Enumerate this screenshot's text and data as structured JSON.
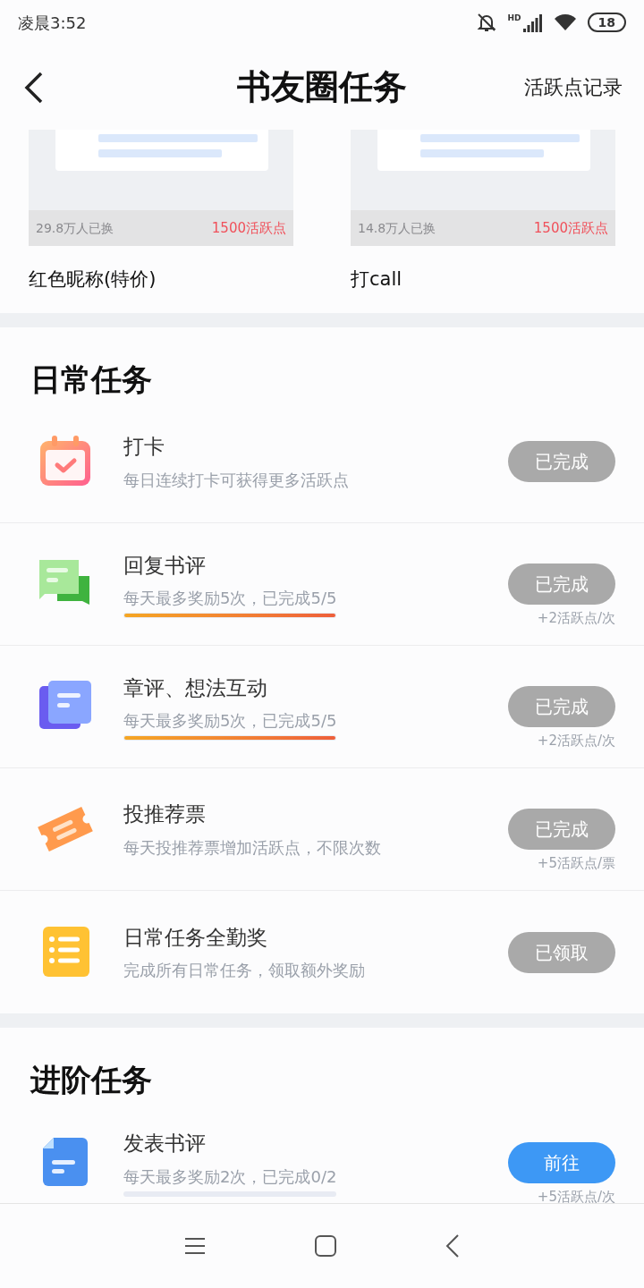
{
  "status_bar": {
    "time": "凌晨3:52",
    "network": "HD",
    "battery": "18"
  },
  "header": {
    "title": "书友圈任务",
    "action": "活跃点记录"
  },
  "rewards": [
    {
      "count": "29.8万人已换",
      "price": "1500活跃点",
      "name": "红色昵称(特价)"
    },
    {
      "count": "14.8万人已换",
      "price": "1500活跃点",
      "name": "打call"
    }
  ],
  "sections": [
    {
      "title": "日常任务",
      "tasks": [
        {
          "kind": "calendar",
          "title": "打卡",
          "desc": "每日连续打卡可获得更多活跃点",
          "button": {
            "label": "已完成",
            "disabled": true
          }
        },
        {
          "kind": "chat",
          "title": "回复书评",
          "desc": "每天最多奖励5次，已完成5/5",
          "progress": {
            "level": 1
          },
          "button": {
            "label": "已完成",
            "disabled": true
          },
          "reward": "+2活跃点/次"
        },
        {
          "kind": "pages",
          "title": "章评、想法互动",
          "desc": "每天最多奖励5次，已完成5/5",
          "progress": {
            "level": 1
          },
          "button": {
            "label": "已完成",
            "disabled": true
          },
          "reward": "+2活跃点/次"
        },
        {
          "kind": "ticket",
          "title": "投推荐票",
          "desc": "每天投推荐票增加活跃点，不限次数",
          "button": {
            "label": "已完成",
            "disabled": true
          },
          "reward": "+5活跃点/票"
        },
        {
          "kind": "list",
          "title": "日常任务全勤奖",
          "desc": "完成所有日常任务，领取额外奖励",
          "button": {
            "label": "已领取",
            "disabled": true
          }
        }
      ]
    },
    {
      "title": "进阶任务",
      "tasks": [
        {
          "kind": "document",
          "title": "发表书评",
          "desc": "每天最多奖励2次，已完成0/2",
          "progress_track": true,
          "button": {
            "label": "前往",
            "disabled": false
          },
          "reward": "+5活跃点/次"
        }
      ]
    }
  ]
}
